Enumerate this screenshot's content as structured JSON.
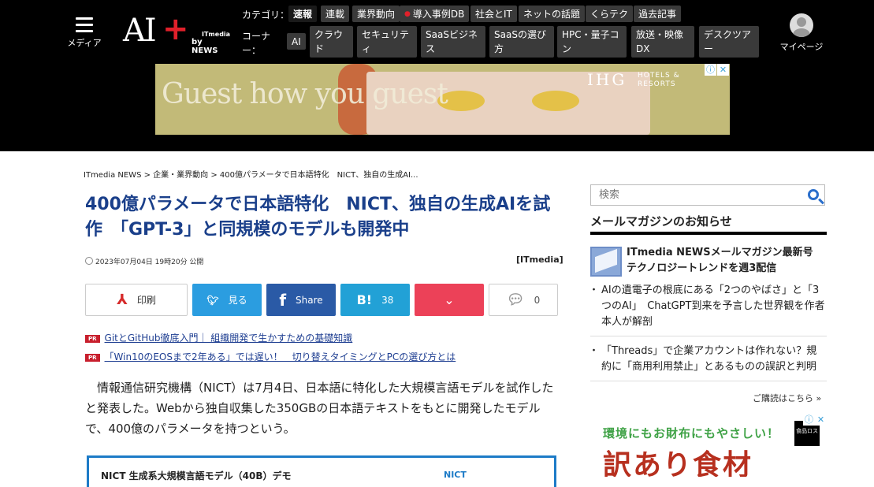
{
  "header": {
    "menu_label": "メディア",
    "logo": {
      "main": "AI",
      "plus": "+",
      "itmedia": "ITmedia",
      "by_news": "by NEWS"
    },
    "category_label": "カテゴリ：",
    "corner_label_1": "コーナ",
    "corner_label_2": "ー：",
    "categories": [
      "速報",
      "連載",
      "業界動向",
      "導入事例DB",
      "社会とIT",
      "ネットの話題",
      "くらテク",
      "過去記事"
    ],
    "corners": [
      {
        "l1": "AI",
        "l2": ""
      },
      {
        "l1": "クラウ",
        "l2": "ド"
      },
      {
        "l1": "セキュリテ",
        "l2": "ィ"
      },
      {
        "l1": "SaaSビジネ",
        "l2": "ス"
      },
      {
        "l1": "SaaSの選び",
        "l2": "方"
      },
      {
        "l1": "HPC・量子コ",
        "l2": "ン"
      },
      {
        "l1": "放送・映像",
        "l2": "DX"
      },
      {
        "l1": "デスクツア",
        "l2": "ー"
      }
    ],
    "mypage_label": "マイページ"
  },
  "ad_banner": {
    "headline": "Guest how you guest",
    "brand": "IHG",
    "brand_sub_1": "HOTELS &",
    "brand_sub_2": "RESORTS",
    "info_icon": "ⓘ",
    "close_icon": "✕"
  },
  "breadcrumb": "ITmedia NEWS > 企業・業界動向 > 400億パラメータで日本語特化　NICT、独自の生成AI...",
  "article": {
    "title": "400億パラメータで日本語特化　NICT、独自の生成AIを試作　「GPT-3」と同規模のモデルも開発中",
    "date": "2023年07月04日 19時20分 公開",
    "source": "[ITmedia]",
    "share": {
      "print": "印刷",
      "twitter": "見る",
      "facebook": "Share",
      "hatena": "38",
      "comments": "0"
    },
    "pr_tag": "PR",
    "pr_links": [
      "GitとGitHub徹底入門｜ 組織開発で生かすための基礎知識",
      "「Win10のEOSまで2年ある」では遅い！　切り替えタイミングとPCの選び方とは"
    ],
    "body": "情報通信研究機構（NICT）は7月4日、日本語に特化した大規模言語モデルを試作したと発表した。Webから独自収集した350GBの日本語テキストをもとに開発したモデルで、400億のパラメータを持つという。",
    "embed_title": "NICT 生成系大規模言語モデル（40B）デモ",
    "embed_brand": "NICT"
  },
  "sidebar": {
    "search_placeholder": "検索",
    "mail_heading": "メールマガジンのお知らせ",
    "mag_title": "ITmedia NEWSメールマガジン最新号　テクノロジートレンドを週3配信",
    "news_items": [
      "AIの遺電子の根底にある「2つのやばさ」と「3つのAI」　ChatGPT到来を予言した世界観を作者本人が解剖",
      "「Threads」で企業アカウントは作れない？規約に「商用利用禁止」とあるものの誤訳と判明"
    ],
    "subscribe": "ご購読はこちら »",
    "ad_line1": "環境にもお財布にもやさしい！",
    "ad_line2": "訳あり食材",
    "ad_stamp": "食品ロス"
  },
  "colors": {
    "title": "#1a3f8a",
    "header_bg": "#000000",
    "twitter": "#2b9de0",
    "facebook": "#2a5aa6",
    "hatena": "#22a1d6",
    "pocket": "#ec4158"
  }
}
